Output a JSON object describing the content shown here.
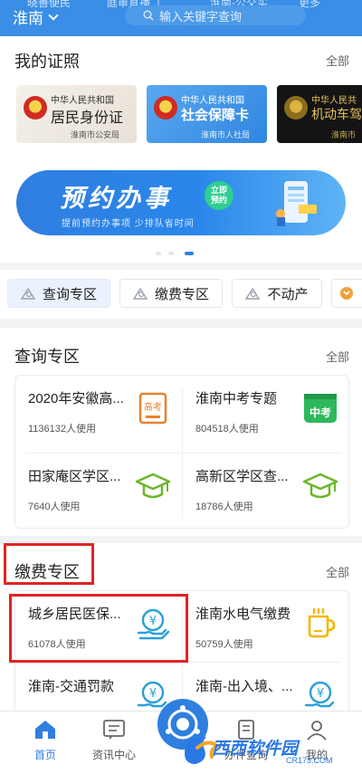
{
  "header": {
    "peek": [
      "晓善便民",
      "庭审直播（",
      "淮南-公交实...",
      "更多"
    ],
    "city": "淮南",
    "search_placeholder": "输入关键字查询"
  },
  "licenses": {
    "title": "我的证照",
    "more": "全部",
    "cards": [
      {
        "top": "中华人民共和国",
        "main": "居民身份证",
        "issuer": "淮南市公安局"
      },
      {
        "top": "中华人民共和国",
        "main": "社会保障卡",
        "issuer": "淮南市人社局"
      },
      {
        "top": "中华人民共",
        "main": "机动车驾",
        "issuer": "淮南市公安"
      }
    ]
  },
  "banner": {
    "title": "预约办事",
    "badge_line1": "立即",
    "badge_line2": "预约",
    "subtitle": "提前预约办事项 少排队省时间"
  },
  "tabs": [
    {
      "label": "查询专区",
      "icon": "search-icon"
    },
    {
      "label": "缴费专区",
      "icon": "payment-icon"
    },
    {
      "label": "不动产",
      "icon": "house-icon"
    }
  ],
  "query_zone": {
    "title": "查询专区",
    "more": "全部",
    "items": [
      {
        "name": "2020年安徽高...",
        "usage": "1136132人使用",
        "icon": "gaokao-icon"
      },
      {
        "name": "淮南中考专题",
        "usage": "804518人使用",
        "icon": "zhongkao-icon",
        "icon_text": "中考"
      },
      {
        "name": "田家庵区学区...",
        "usage": "7640人使用",
        "icon": "graduation-cap-icon"
      },
      {
        "name": "高新区学区查...",
        "usage": "18786人使用",
        "icon": "graduation-cap-icon"
      }
    ],
    "gaokao_icon_text": "高考"
  },
  "payment_zone": {
    "title": "缴费专区",
    "more": "全部",
    "items": [
      {
        "name": "城乡居民医保...",
        "usage": "61078人使用",
        "icon": "yuan-hand-icon"
      },
      {
        "name": "淮南水电气缴费",
        "usage": "50759人使用",
        "icon": "cup-icon"
      },
      {
        "name": "淮南-交通罚款",
        "usage": "",
        "icon": "yuan-hand-icon"
      },
      {
        "name": "淮南-出入境、...",
        "usage": "",
        "icon": "yuan-hand-icon"
      }
    ]
  },
  "nav": {
    "items": [
      {
        "label": "首页",
        "icon": "home-icon"
      },
      {
        "label": "资讯中心",
        "icon": "news-icon"
      },
      {
        "label": "办件查询",
        "icon": "document-icon"
      },
      {
        "label": "我的",
        "icon": "user-icon"
      }
    ]
  },
  "watermark": {
    "text": "西西软件园",
    "url": "CR173.COM"
  },
  "colors": {
    "primary": "#2f7fe0",
    "highlight": "#e02424",
    "green": "#2eb85c",
    "orange": "#e8812c",
    "yellow": "#f2b705"
  }
}
